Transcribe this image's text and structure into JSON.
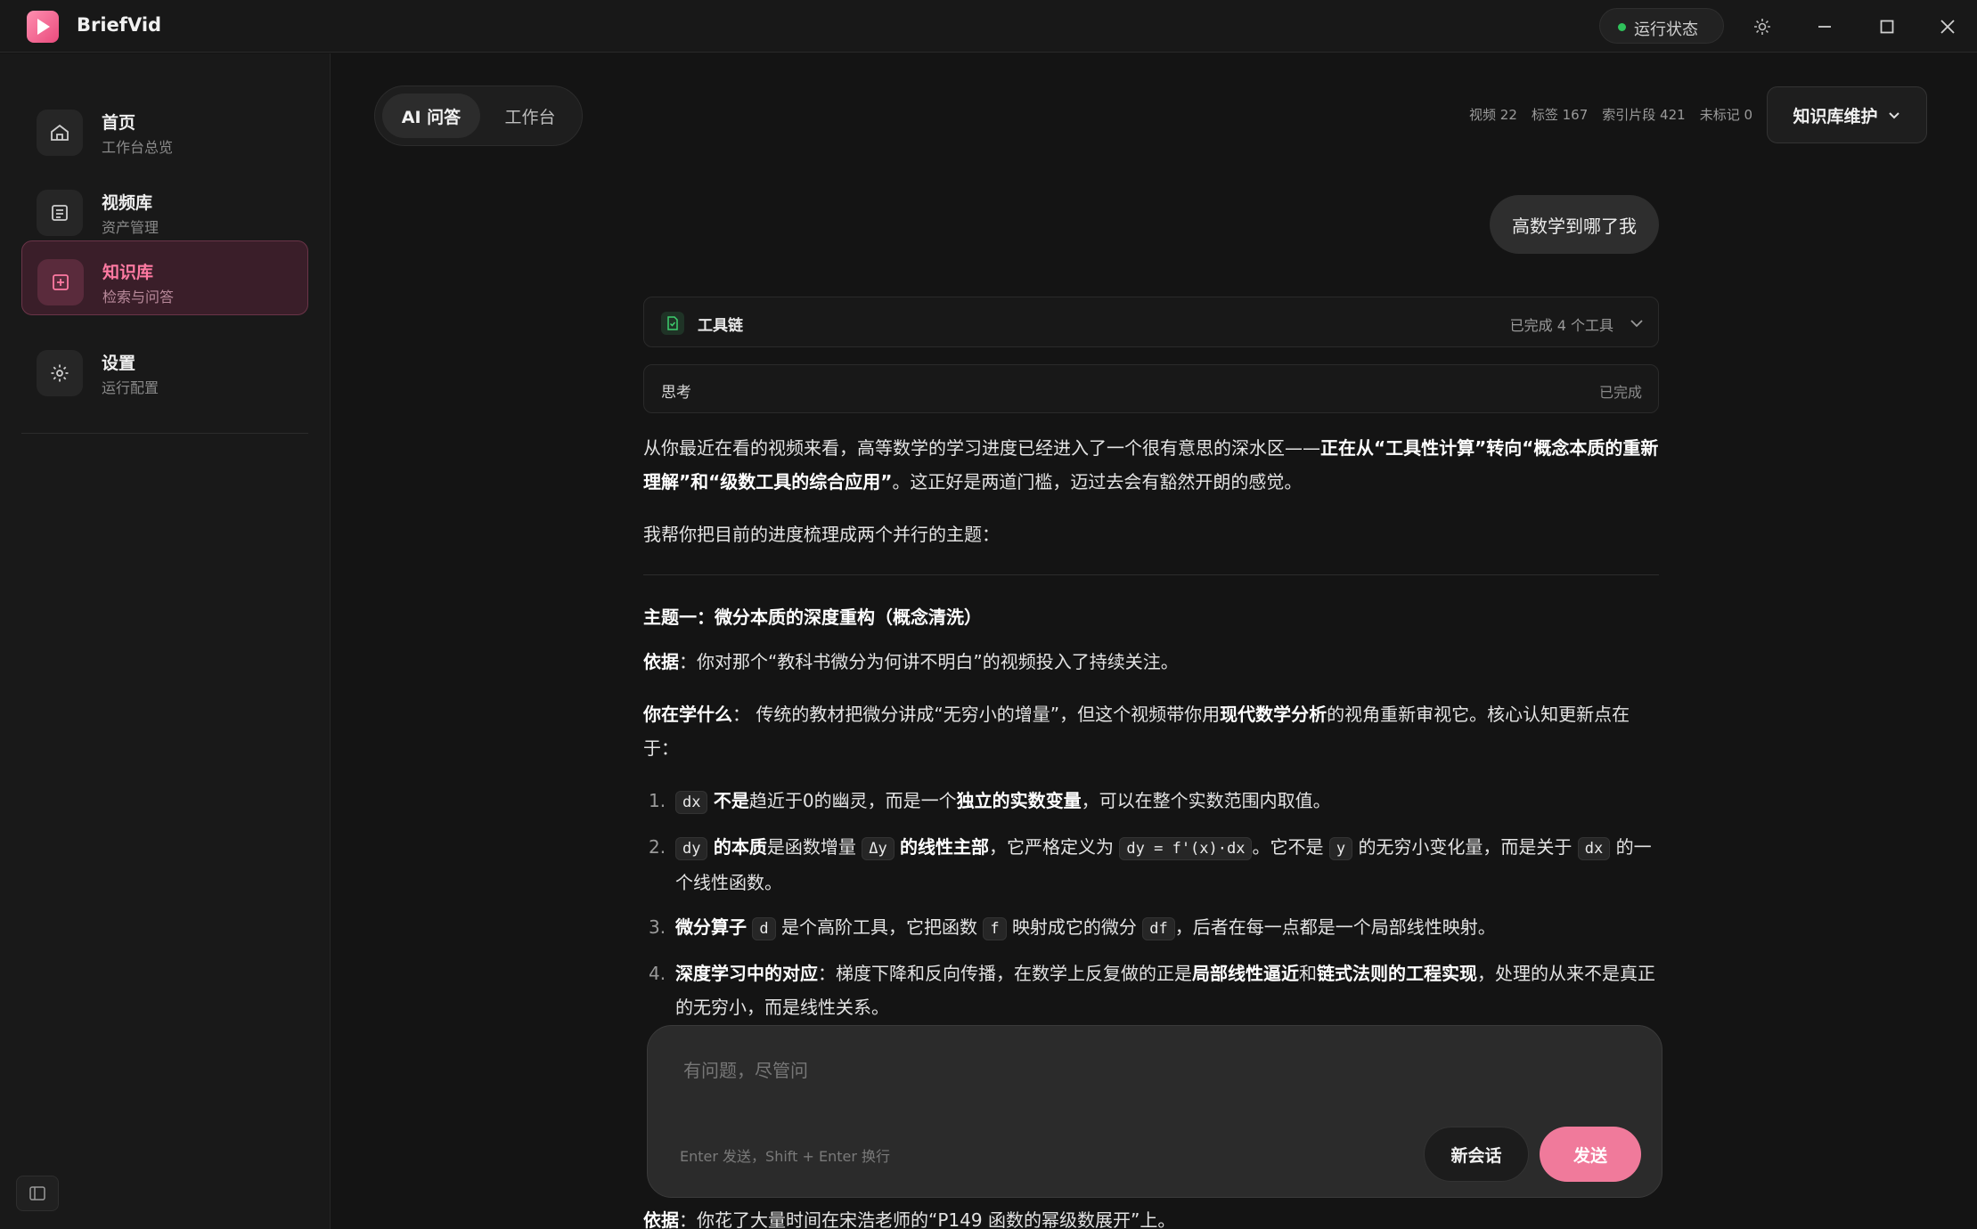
{
  "window": {
    "app_name": "BriefVid",
    "status_label": "运行状态",
    "icons": {
      "logo": "play-logo-icon",
      "theme": "sun-icon",
      "minimize": "minimize-icon",
      "maximize": "maximize-icon",
      "close": "close-icon"
    }
  },
  "sidebar": {
    "items": [
      {
        "title": "首页",
        "subtitle": "工作台总览",
        "icon": "home-icon",
        "active": false
      },
      {
        "title": "视频库",
        "subtitle": "资产管理",
        "icon": "library-icon",
        "active": false
      },
      {
        "title": "知识库",
        "subtitle": "检索与问答",
        "icon": "knowledge-icon",
        "active": true
      },
      {
        "title": "设置",
        "subtitle": "运行配置",
        "icon": "gear-icon",
        "active": false
      }
    ]
  },
  "header": {
    "tabs": [
      {
        "label": "AI 问答",
        "active": true
      },
      {
        "label": "工作台",
        "active": false
      }
    ],
    "stats": [
      "视频 22",
      "标签 167",
      "索引片段 421",
      "未标记 0"
    ],
    "kb_button": "知识库维护"
  },
  "chat": {
    "user_message": "高数学到哪了我",
    "tool_chain": {
      "label": "工具链",
      "status": "已完成 4 个工具"
    },
    "thinking": {
      "label": "思考",
      "status": "已完成"
    },
    "answer": {
      "intro_a": "从你最近在看的视频来看，高等数学的学习进度已经进入了一个很有意思的深水区——",
      "intro_bold": "正在从“工具性计算”转向“概念本质的重新理解”和“级数工具的综合应用”",
      "intro_b": "。这正好是两道门槛，迈过去会有豁然开朗的感觉。",
      "summary": "我帮你把目前的进度梳理成两个并行的主题：",
      "theme1_title": "主题一：微分本质的深度重构（概念清洗）",
      "basis_label": "依据",
      "basis_text": "：你对那个“教科书微分为何讲不明白”的视频投入了持续关注。",
      "learning_label": "你在学什么",
      "learning_a": "： 传统的教材把微分讲成“无穷小的增量”，但这个视频带你用",
      "learning_bold": "现代数学分析",
      "learning_b": "的视角重新审视它。核心认知更新点在于：",
      "item1": {
        "num": "1.",
        "code": "dx",
        "bold": "不是",
        "text": "趋近于0的幽灵，而是一个",
        "bold2": "独立的实数变量",
        "text2": "，可以在整个实数范围内取值。"
      },
      "item2": {
        "num": "2.",
        "code": "dy",
        "bold": "的本质",
        "text": "是函数增量",
        "code2": "Δy",
        "bold2": "的线性主部",
        "text2": "，它严格定义为",
        "code3": "dy = f'(x)·dx",
        "text3": "。它不是",
        "code4": "y",
        "text4": "的无穷小变化量，而是关于",
        "code5": "dx",
        "text5": "的一个线性函数。"
      },
      "item3": {
        "num": "3.",
        "bold": "微分算子",
        "code": "d",
        "text": "是个高阶工具，它把函数",
        "code2": "f",
        "text2": "映射成它的微分",
        "code3": "df",
        "text3": "，后者在每一点都是一个局部线性映射。"
      },
      "item4": {
        "num": "4.",
        "bold": "深度学习中的对应",
        "text": "：梯度下降和反向传播，在数学上反复做的正是",
        "bold2": "局部线性逼近",
        "text2": "和",
        "bold3": "链式法则的工程实现",
        "text3": "，处理的从来不是真正的无穷小，而是线性关系。"
      },
      "basis2_text": "：你花了大量时间在宋浩老师的“P149 函数的幂级数展开”上。"
    }
  },
  "composer": {
    "placeholder": "有问题，尽管问",
    "hint": "Enter 发送，Shift + Enter 换行",
    "new_chat": "新会话",
    "send": "发送"
  },
  "colors": {
    "accent": "#f07a9b",
    "status_ok": "#2fc25b",
    "background": "#141414"
  }
}
